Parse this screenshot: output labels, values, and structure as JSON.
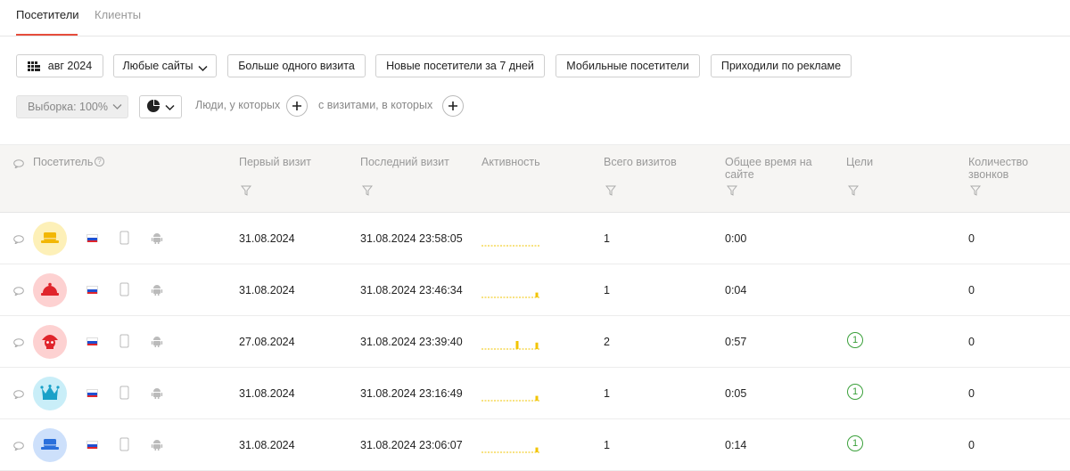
{
  "tabs": {
    "visitors": "Посетители",
    "clients": "Клиенты"
  },
  "filters": {
    "period": "авг 2024",
    "sites": "Любые сайты",
    "more_than_one_visit": "Больше одного визита",
    "new_visitors_7d": "Новые посетители за 7 дней",
    "mobile_visitors": "Мобильные посетители",
    "from_ads": "Приходили по рекламе"
  },
  "segment": {
    "sample": "Выборка: 100%",
    "people_label": "Люди, у которых",
    "visits_label": "с визитами, в которых"
  },
  "table": {
    "headers": {
      "visitor": "Посетитель",
      "first_visit": "Первый визит",
      "last_visit": "Последний визит",
      "activity": "Активность",
      "total_visits": "Всего визитов",
      "total_time_l1": "Общее время на",
      "total_time_l2": "сайте",
      "goals": "Цели",
      "calls_l1": "Количество",
      "calls_l2": "звонков"
    },
    "rows": [
      {
        "avatar_color": "#fdf0b8",
        "icon_color": "#f2b705",
        "icon": "hat-icon",
        "first": "31.08.2024",
        "last": "31.08.2024 23:58:05",
        "activity": [
          0,
          0,
          0,
          0,
          0,
          0,
          0,
          0,
          0,
          0,
          0,
          0
        ],
        "visits": "1",
        "time": "0:00",
        "goals": "",
        "calls": "0"
      },
      {
        "avatar_color": "#fdd1d1",
        "icon_color": "#e0242b",
        "icon": "bell-icon",
        "first": "31.08.2024",
        "last": "31.08.2024 23:46:34",
        "activity": [
          0,
          0,
          0,
          0,
          0,
          0,
          0,
          0,
          0,
          0,
          0,
          0.3
        ],
        "visits": "1",
        "time": "0:04",
        "goals": "",
        "calls": "0"
      },
      {
        "avatar_color": "#fdd1d1",
        "icon_color": "#e0242b",
        "icon": "pirate-icon",
        "first": "27.08.2024",
        "last": "31.08.2024 23:39:40",
        "activity": [
          0,
          0,
          0,
          0,
          0,
          0,
          0,
          0.5,
          0,
          0,
          0,
          0.4
        ],
        "visits": "2",
        "time": "0:57",
        "goals": "1",
        "calls": "0"
      },
      {
        "avatar_color": "#c9eef8",
        "icon_color": "#1aa1c8",
        "icon": "crown-icon",
        "first": "31.08.2024",
        "last": "31.08.2024 23:16:49",
        "activity": [
          0,
          0,
          0,
          0,
          0,
          0,
          0,
          0,
          0,
          0,
          0,
          0.3
        ],
        "visits": "1",
        "time": "0:05",
        "goals": "1",
        "calls": "0"
      },
      {
        "avatar_color": "#cde0fb",
        "icon_color": "#2a6fdb",
        "icon": "hat-icon",
        "first": "31.08.2024",
        "last": "31.08.2024 23:06:07",
        "activity": [
          0,
          0,
          0,
          0,
          0,
          0,
          0,
          0,
          0,
          0,
          0,
          0.3
        ],
        "visits": "1",
        "time": "0:14",
        "goals": "1",
        "calls": "0"
      }
    ]
  }
}
